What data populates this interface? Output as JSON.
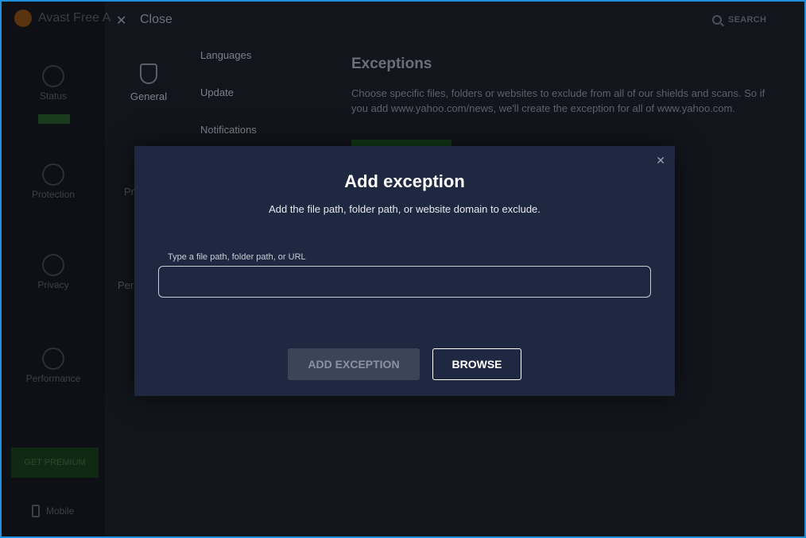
{
  "app": {
    "name": "Avast Free A"
  },
  "topbar": {
    "close_label": "Close",
    "search_label": "SEARCH"
  },
  "sidebar": {
    "items": [
      {
        "label": "Status"
      },
      {
        "label": "Protection"
      },
      {
        "label": "Privacy"
      },
      {
        "label": "Performance"
      }
    ],
    "get_premium": "GET PREMIUM",
    "mobile": "Mobile"
  },
  "categories": {
    "general": "General",
    "truncated": [
      "Pr",
      "Per"
    ]
  },
  "submenu": [
    "Languages",
    "Update",
    "Notifications"
  ],
  "content": {
    "title": "Exceptions",
    "description": "Choose specific files, folders or websites to exclude from all of our shields and scans. So if you add www.yahoo.com/news, we'll create the exception for all of www.yahoo.com."
  },
  "modal": {
    "title": "Add exception",
    "subtitle": "Add the file path, folder path, or website domain to exclude.",
    "field_label": "Type a file path, folder path, or URL",
    "field_value": "",
    "add_button": "ADD EXCEPTION",
    "browse_button": "BROWSE"
  },
  "colors": {
    "modal_bg": "#1e2840",
    "window_border": "#1e8fd8",
    "disabled_button": "#3c4558"
  }
}
